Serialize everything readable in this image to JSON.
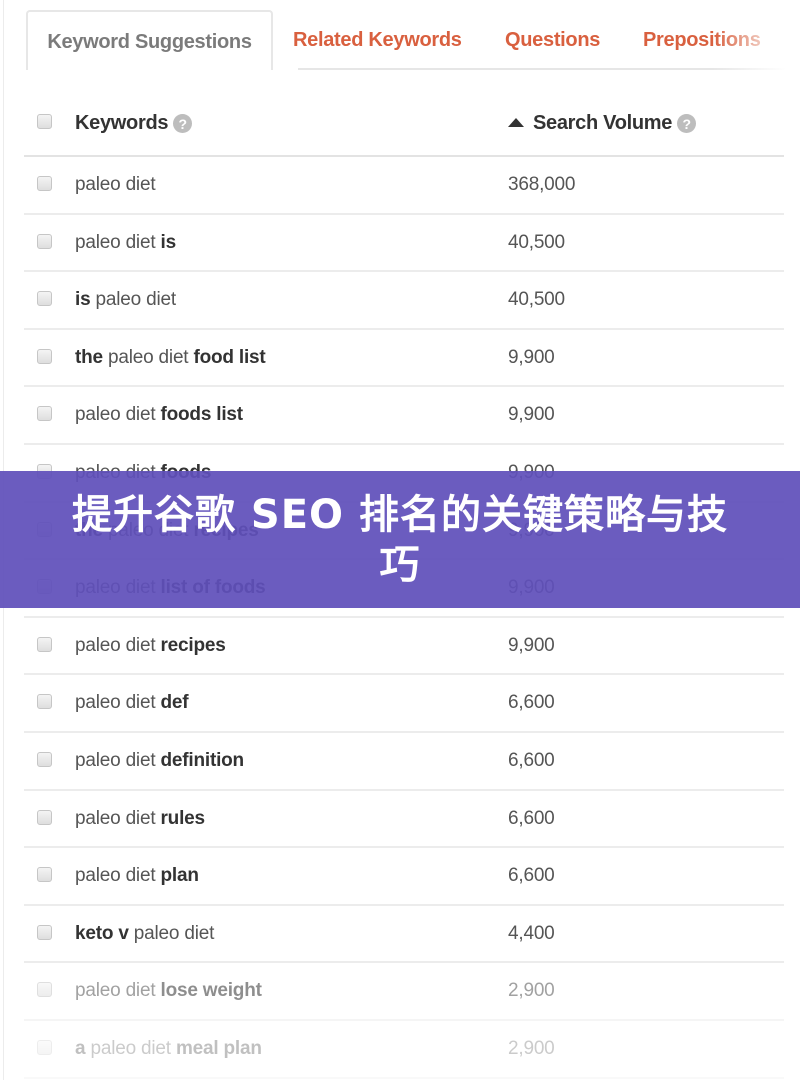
{
  "tabs": [
    {
      "label": "Keyword Suggestions",
      "active": true
    },
    {
      "label": "Related Keywords",
      "active": false
    },
    {
      "label": "Questions",
      "active": false
    },
    {
      "label": "Prepositions",
      "active": false
    }
  ],
  "table": {
    "columns": {
      "keywords": {
        "label": "Keywords",
        "help_icon": "question-circle-icon"
      },
      "search_volume": {
        "label": "Search Volume",
        "help_icon": "question-circle-icon",
        "sort": "ascending",
        "sort_icon": "triangle-up-icon"
      }
    },
    "rows": [
      {
        "parts": [
          [
            "paleo diet",
            false
          ]
        ],
        "volume": "368,000"
      },
      {
        "parts": [
          [
            "paleo diet ",
            false
          ],
          [
            "is",
            true
          ]
        ],
        "volume": "40,500"
      },
      {
        "parts": [
          [
            "is",
            true
          ],
          [
            " paleo diet",
            false
          ]
        ],
        "volume": "40,500"
      },
      {
        "parts": [
          [
            "the",
            true
          ],
          [
            " paleo diet ",
            false
          ],
          [
            "food list",
            true
          ]
        ],
        "volume": "9,900"
      },
      {
        "parts": [
          [
            "paleo diet ",
            false
          ],
          [
            "foods list",
            true
          ]
        ],
        "volume": "9,900"
      },
      {
        "parts": [
          [
            "paleo diet ",
            false
          ],
          [
            "foods",
            true
          ]
        ],
        "volume": "9,900"
      },
      {
        "parts": [
          [
            "the",
            true
          ],
          [
            " paleo diet ",
            false
          ],
          [
            "recipes",
            true
          ]
        ],
        "volume": "9,900"
      },
      {
        "parts": [
          [
            "paleo diet ",
            false
          ],
          [
            "list of foods",
            true
          ]
        ],
        "volume": "9,900"
      },
      {
        "parts": [
          [
            "paleo diet ",
            false
          ],
          [
            "recipes",
            true
          ]
        ],
        "volume": "9,900"
      },
      {
        "parts": [
          [
            "paleo diet ",
            false
          ],
          [
            "def",
            true
          ]
        ],
        "volume": "6,600"
      },
      {
        "parts": [
          [
            "paleo diet ",
            false
          ],
          [
            "definition",
            true
          ]
        ],
        "volume": "6,600"
      },
      {
        "parts": [
          [
            "paleo diet ",
            false
          ],
          [
            "rules",
            true
          ]
        ],
        "volume": "6,600"
      },
      {
        "parts": [
          [
            "paleo diet ",
            false
          ],
          [
            "plan",
            true
          ]
        ],
        "volume": "6,600"
      },
      {
        "parts": [
          [
            "keto v",
            true
          ],
          [
            " paleo diet",
            false
          ]
        ],
        "volume": "4,400"
      },
      {
        "parts": [
          [
            "paleo diet ",
            false
          ],
          [
            "lose weight",
            true
          ]
        ],
        "volume": "2,900"
      },
      {
        "parts": [
          [
            "a",
            true
          ],
          [
            " paleo diet ",
            false
          ],
          [
            "meal plan",
            true
          ]
        ],
        "volume": "2,900"
      }
    ]
  },
  "banner": {
    "title": "提升谷歌 SEO 排名的关键策略与技巧",
    "background_color": "#6050BA",
    "text_color": "#FFFFFF"
  },
  "colors": {
    "tab_active_text": "#7B7B7B",
    "tab_inactive_text": "#D9603F",
    "header_text": "#333333",
    "cell_text": "#555555"
  }
}
